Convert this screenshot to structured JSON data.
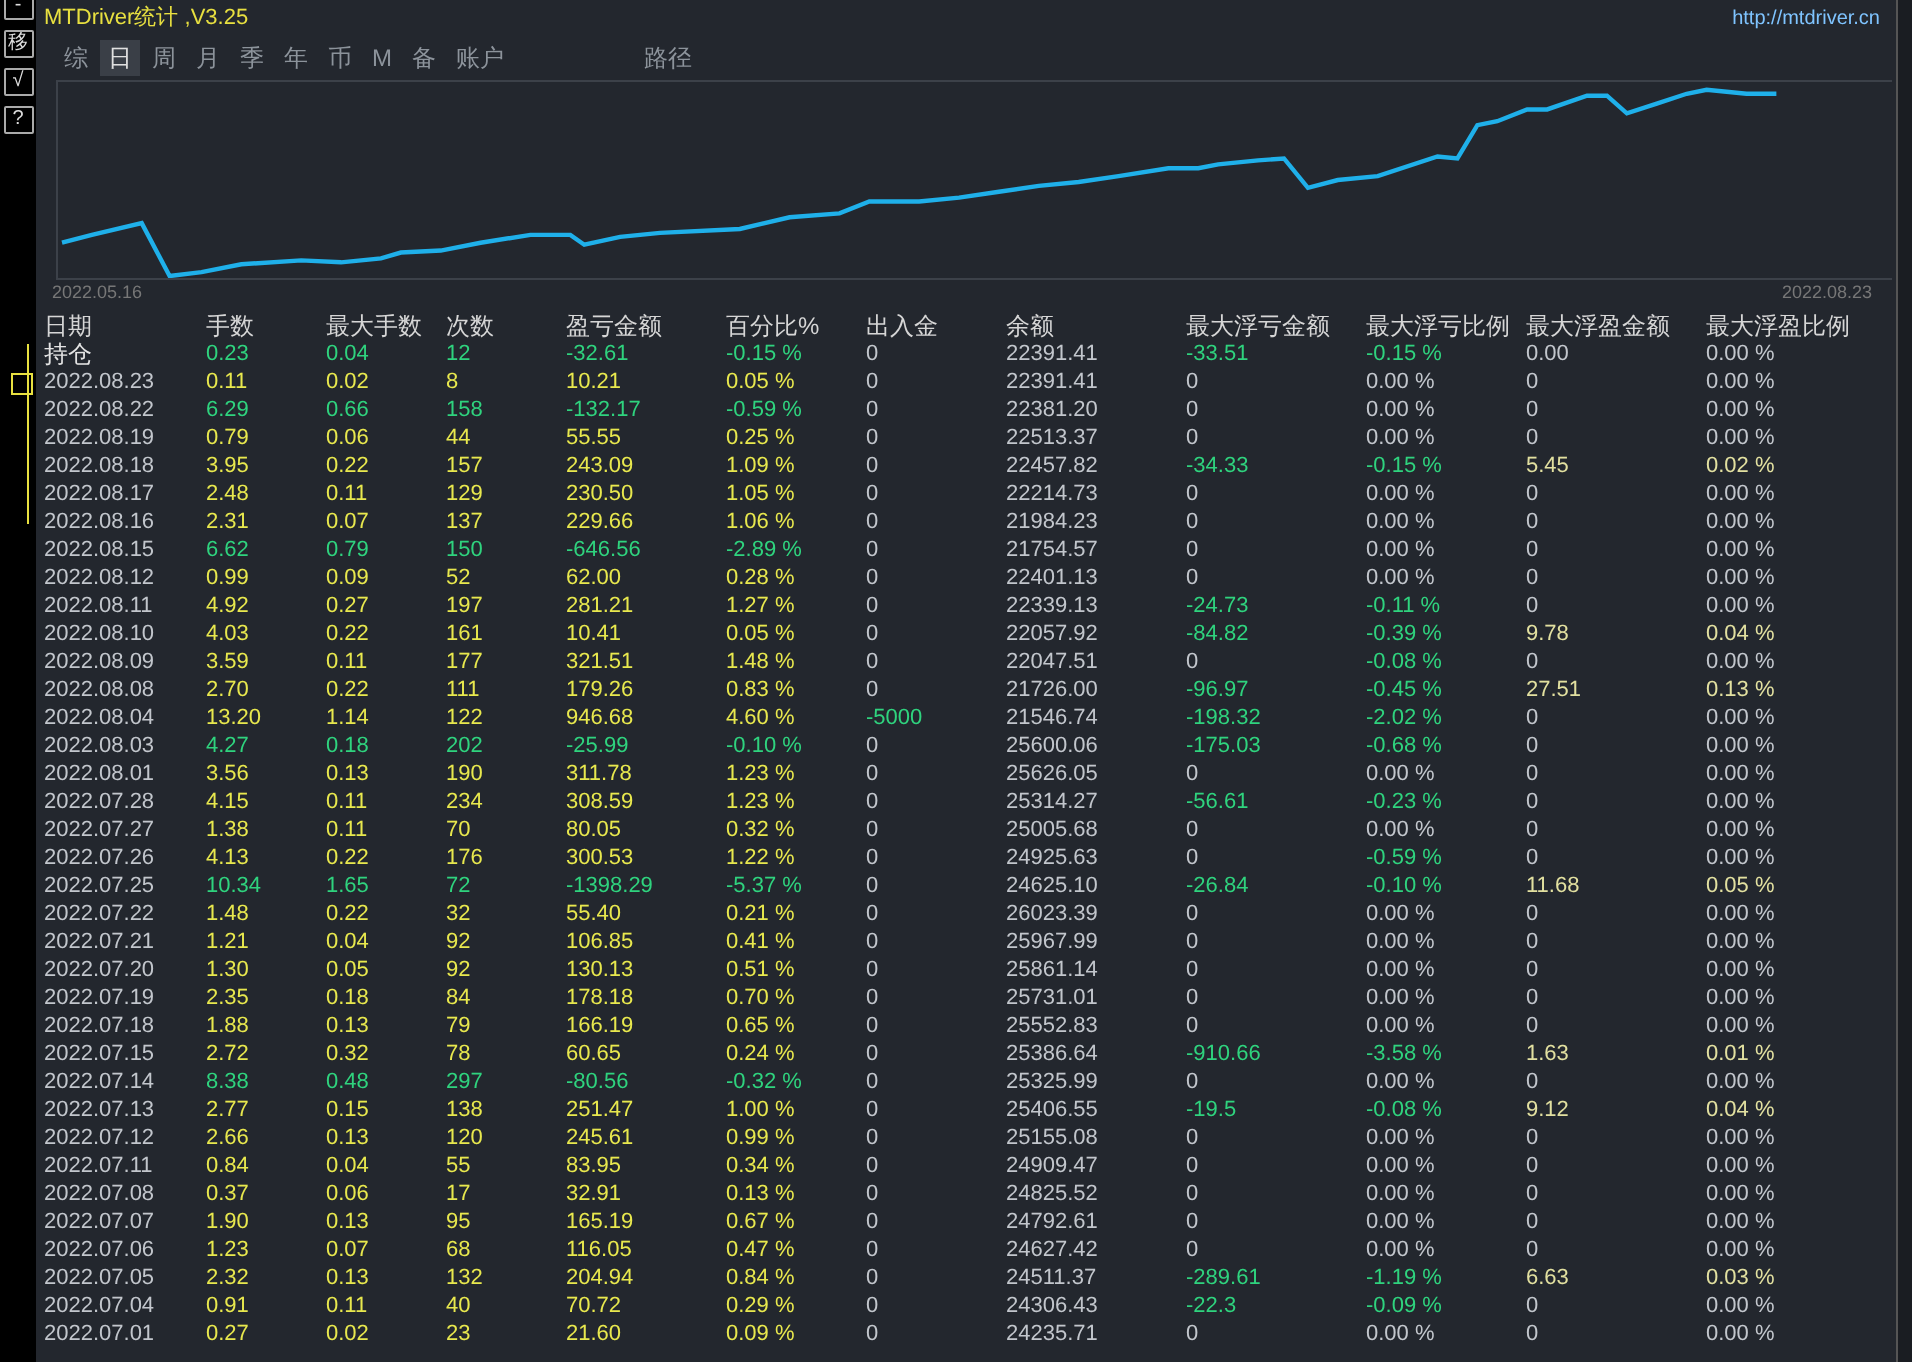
{
  "side_buttons": [
    "-",
    "移",
    "√",
    "?"
  ],
  "header": {
    "title": "MTDriver统计 ,V3.25",
    "url": "http://mtdriver.cn"
  },
  "tabs": [
    {
      "label": "综",
      "selected": false
    },
    {
      "label": "日",
      "selected": true
    },
    {
      "label": "周",
      "selected": false
    },
    {
      "label": "月",
      "selected": false
    },
    {
      "label": "季",
      "selected": false
    },
    {
      "label": "年",
      "selected": false
    },
    {
      "label": "币",
      "selected": false
    },
    {
      "label": "M",
      "selected": false
    },
    {
      "label": "备",
      "selected": false
    },
    {
      "label": "账户",
      "selected": false
    },
    {
      "label": "路径",
      "selected": false
    }
  ],
  "chart": {
    "start_label": "2022.05.16",
    "end_label": "2022.08.23"
  },
  "table": {
    "columns": [
      "日期",
      "手数",
      "最大手数",
      "次数",
      "盈亏金额",
      "百分比%",
      "出入金",
      "余额",
      "最大浮亏金额",
      "最大浮亏比例",
      "最大浮盈金额",
      "最大浮盈比例"
    ],
    "rows": [
      {
        "kind": "position",
        "cells": [
          "持仓",
          "0.23",
          "0.04",
          "12",
          "-32.61",
          "-0.15 %",
          "0",
          "22391.41",
          "-33.51",
          "-0.15 %",
          "0.00",
          "0.00 %"
        ],
        "deposit_marked": false,
        "float_loss_marked": true,
        "float_loss_pct_marked": true,
        "float_profit_marked": false
      },
      {
        "kind": "gain",
        "cells": [
          "2022.08.23",
          "0.11",
          "0.02",
          "8",
          "10.21",
          "0.05 %",
          "0",
          "22391.41",
          "0",
          "0.00 %",
          "0",
          "0.00 %"
        ],
        "deposit_marked": false,
        "float_loss_marked": false,
        "float_loss_pct_marked": false,
        "float_profit_marked": false
      },
      {
        "kind": "loss",
        "cells": [
          "2022.08.22",
          "6.29",
          "0.66",
          "158",
          "-132.17",
          "-0.59 %",
          "0",
          "22381.20",
          "0",
          "0.00 %",
          "0",
          "0.00 %"
        ],
        "deposit_marked": false,
        "float_loss_marked": false,
        "float_loss_pct_marked": false,
        "float_profit_marked": false
      },
      {
        "kind": "gain",
        "cells": [
          "2022.08.19",
          "0.79",
          "0.06",
          "44",
          "55.55",
          "0.25 %",
          "0",
          "22513.37",
          "0",
          "0.00 %",
          "0",
          "0.00 %"
        ],
        "deposit_marked": false,
        "float_loss_marked": false,
        "float_loss_pct_marked": false,
        "float_profit_marked": false
      },
      {
        "kind": "gain",
        "cells": [
          "2022.08.18",
          "3.95",
          "0.22",
          "157",
          "243.09",
          "1.09 %",
          "0",
          "22457.82",
          "-34.33",
          "-0.15 %",
          "5.45",
          "0.02 %"
        ],
        "deposit_marked": false,
        "float_loss_marked": true,
        "float_loss_pct_marked": true,
        "float_profit_marked": true
      },
      {
        "kind": "gain",
        "cells": [
          "2022.08.17",
          "2.48",
          "0.11",
          "129",
          "230.50",
          "1.05 %",
          "0",
          "22214.73",
          "0",
          "0.00 %",
          "0",
          "0.00 %"
        ],
        "deposit_marked": false,
        "float_loss_marked": false,
        "float_loss_pct_marked": false,
        "float_profit_marked": false
      },
      {
        "kind": "gain",
        "cells": [
          "2022.08.16",
          "2.31",
          "0.07",
          "137",
          "229.66",
          "1.06 %",
          "0",
          "21984.23",
          "0",
          "0.00 %",
          "0",
          "0.00 %"
        ],
        "deposit_marked": false,
        "float_loss_marked": false,
        "float_loss_pct_marked": false,
        "float_profit_marked": false
      },
      {
        "kind": "loss",
        "cells": [
          "2022.08.15",
          "6.62",
          "0.79",
          "150",
          "-646.56",
          "-2.89 %",
          "0",
          "21754.57",
          "0",
          "0.00 %",
          "0",
          "0.00 %"
        ],
        "deposit_marked": false,
        "float_loss_marked": false,
        "float_loss_pct_marked": false,
        "float_profit_marked": false
      },
      {
        "kind": "gain",
        "cells": [
          "2022.08.12",
          "0.99",
          "0.09",
          "52",
          "62.00",
          "0.28 %",
          "0",
          "22401.13",
          "0",
          "0.00 %",
          "0",
          "0.00 %"
        ],
        "deposit_marked": false,
        "float_loss_marked": false,
        "float_loss_pct_marked": false,
        "float_profit_marked": false
      },
      {
        "kind": "gain",
        "cells": [
          "2022.08.11",
          "4.92",
          "0.27",
          "197",
          "281.21",
          "1.27 %",
          "0",
          "22339.13",
          "-24.73",
          "-0.11 %",
          "0",
          "0.00 %"
        ],
        "deposit_marked": false,
        "float_loss_marked": true,
        "float_loss_pct_marked": true,
        "float_profit_marked": false
      },
      {
        "kind": "gain",
        "cells": [
          "2022.08.10",
          "4.03",
          "0.22",
          "161",
          "10.41",
          "0.05 %",
          "0",
          "22057.92",
          "-84.82",
          "-0.39 %",
          "9.78",
          "0.04 %"
        ],
        "deposit_marked": false,
        "float_loss_marked": true,
        "float_loss_pct_marked": true,
        "float_profit_marked": true
      },
      {
        "kind": "gain",
        "cells": [
          "2022.08.09",
          "3.59",
          "0.11",
          "177",
          "321.51",
          "1.48 %",
          "0",
          "22047.51",
          "0",
          "-0.08 %",
          "0",
          "0.00 %"
        ],
        "deposit_marked": false,
        "float_loss_marked": false,
        "float_loss_pct_marked": true,
        "float_profit_marked": false
      },
      {
        "kind": "gain",
        "cells": [
          "2022.08.08",
          "2.70",
          "0.22",
          "111",
          "179.26",
          "0.83 %",
          "0",
          "21726.00",
          "-96.97",
          "-0.45 %",
          "27.51",
          "0.13 %"
        ],
        "deposit_marked": false,
        "float_loss_marked": true,
        "float_loss_pct_marked": true,
        "float_profit_marked": true
      },
      {
        "kind": "gain",
        "cells": [
          "2022.08.04",
          "13.20",
          "1.14",
          "122",
          "946.68",
          "4.60 %",
          "-5000",
          "21546.74",
          "-198.32",
          "-2.02 %",
          "0",
          "0.00 %"
        ],
        "deposit_marked": true,
        "float_loss_marked": true,
        "float_loss_pct_marked": true,
        "float_profit_marked": false
      },
      {
        "kind": "loss",
        "cells": [
          "2022.08.03",
          "4.27",
          "0.18",
          "202",
          "-25.99",
          "-0.10 %",
          "0",
          "25600.06",
          "-175.03",
          "-0.68 %",
          "0",
          "0.00 %"
        ],
        "deposit_marked": false,
        "float_loss_marked": true,
        "float_loss_pct_marked": true,
        "float_profit_marked": false
      },
      {
        "kind": "gain",
        "cells": [
          "2022.08.01",
          "3.56",
          "0.13",
          "190",
          "311.78",
          "1.23 %",
          "0",
          "25626.05",
          "0",
          "0.00 %",
          "0",
          "0.00 %"
        ],
        "deposit_marked": false,
        "float_loss_marked": false,
        "float_loss_pct_marked": false,
        "float_profit_marked": false
      },
      {
        "kind": "gain",
        "cells": [
          "2022.07.28",
          "4.15",
          "0.11",
          "234",
          "308.59",
          "1.23 %",
          "0",
          "25314.27",
          "-56.61",
          "-0.23 %",
          "0",
          "0.00 %"
        ],
        "deposit_marked": false,
        "float_loss_marked": true,
        "float_loss_pct_marked": true,
        "float_profit_marked": false
      },
      {
        "kind": "gain",
        "cells": [
          "2022.07.27",
          "1.38",
          "0.11",
          "70",
          "80.05",
          "0.32 %",
          "0",
          "25005.68",
          "0",
          "0.00 %",
          "0",
          "0.00 %"
        ],
        "deposit_marked": false,
        "float_loss_marked": false,
        "float_loss_pct_marked": false,
        "float_profit_marked": false
      },
      {
        "kind": "gain",
        "cells": [
          "2022.07.26",
          "4.13",
          "0.22",
          "176",
          "300.53",
          "1.22 %",
          "0",
          "24925.63",
          "0",
          "-0.59 %",
          "0",
          "0.00 %"
        ],
        "deposit_marked": false,
        "float_loss_marked": false,
        "float_loss_pct_marked": true,
        "float_profit_marked": false
      },
      {
        "kind": "loss",
        "cells": [
          "2022.07.25",
          "10.34",
          "1.65",
          "72",
          "-1398.29",
          "-5.37 %",
          "0",
          "24625.10",
          "-26.84",
          "-0.10 %",
          "11.68",
          "0.05 %"
        ],
        "deposit_marked": false,
        "float_loss_marked": true,
        "float_loss_pct_marked": true,
        "float_profit_marked": true
      },
      {
        "kind": "gain",
        "cells": [
          "2022.07.22",
          "1.48",
          "0.22",
          "32",
          "55.40",
          "0.21 %",
          "0",
          "26023.39",
          "0",
          "0.00 %",
          "0",
          "0.00 %"
        ],
        "deposit_marked": false,
        "float_loss_marked": false,
        "float_loss_pct_marked": false,
        "float_profit_marked": false
      },
      {
        "kind": "gain",
        "cells": [
          "2022.07.21",
          "1.21",
          "0.04",
          "92",
          "106.85",
          "0.41 %",
          "0",
          "25967.99",
          "0",
          "0.00 %",
          "0",
          "0.00 %"
        ],
        "deposit_marked": false,
        "float_loss_marked": false,
        "float_loss_pct_marked": false,
        "float_profit_marked": false
      },
      {
        "kind": "gain",
        "cells": [
          "2022.07.20",
          "1.30",
          "0.05",
          "92",
          "130.13",
          "0.51 %",
          "0",
          "25861.14",
          "0",
          "0.00 %",
          "0",
          "0.00 %"
        ],
        "deposit_marked": false,
        "float_loss_marked": false,
        "float_loss_pct_marked": false,
        "float_profit_marked": false
      },
      {
        "kind": "gain",
        "cells": [
          "2022.07.19",
          "2.35",
          "0.18",
          "84",
          "178.18",
          "0.70 %",
          "0",
          "25731.01",
          "0",
          "0.00 %",
          "0",
          "0.00 %"
        ],
        "deposit_marked": false,
        "float_loss_marked": false,
        "float_loss_pct_marked": false,
        "float_profit_marked": false
      },
      {
        "kind": "gain",
        "cells": [
          "2022.07.18",
          "1.88",
          "0.13",
          "79",
          "166.19",
          "0.65 %",
          "0",
          "25552.83",
          "0",
          "0.00 %",
          "0",
          "0.00 %"
        ],
        "deposit_marked": false,
        "float_loss_marked": false,
        "float_loss_pct_marked": false,
        "float_profit_marked": false
      },
      {
        "kind": "gain",
        "cells": [
          "2022.07.15",
          "2.72",
          "0.32",
          "78",
          "60.65",
          "0.24 %",
          "0",
          "25386.64",
          "-910.66",
          "-3.58 %",
          "1.63",
          "0.01 %"
        ],
        "deposit_marked": false,
        "float_loss_marked": true,
        "float_loss_pct_marked": true,
        "float_profit_marked": true
      },
      {
        "kind": "loss",
        "cells": [
          "2022.07.14",
          "8.38",
          "0.48",
          "297",
          "-80.56",
          "-0.32 %",
          "0",
          "25325.99",
          "0",
          "0.00 %",
          "0",
          "0.00 %"
        ],
        "deposit_marked": false,
        "float_loss_marked": false,
        "float_loss_pct_marked": false,
        "float_profit_marked": false
      },
      {
        "kind": "gain",
        "cells": [
          "2022.07.13",
          "2.77",
          "0.15",
          "138",
          "251.47",
          "1.00 %",
          "0",
          "25406.55",
          "-19.5",
          "-0.08 %",
          "9.12",
          "0.04 %"
        ],
        "deposit_marked": false,
        "float_loss_marked": true,
        "float_loss_pct_marked": true,
        "float_profit_marked": true
      },
      {
        "kind": "gain",
        "cells": [
          "2022.07.12",
          "2.66",
          "0.13",
          "120",
          "245.61",
          "0.99 %",
          "0",
          "25155.08",
          "0",
          "0.00 %",
          "0",
          "0.00 %"
        ],
        "deposit_marked": false,
        "float_loss_marked": false,
        "float_loss_pct_marked": false,
        "float_profit_marked": false
      },
      {
        "kind": "gain",
        "cells": [
          "2022.07.11",
          "0.84",
          "0.04",
          "55",
          "83.95",
          "0.34 %",
          "0",
          "24909.47",
          "0",
          "0.00 %",
          "0",
          "0.00 %"
        ],
        "deposit_marked": false,
        "float_loss_marked": false,
        "float_loss_pct_marked": false,
        "float_profit_marked": false
      },
      {
        "kind": "gain",
        "cells": [
          "2022.07.08",
          "0.37",
          "0.06",
          "17",
          "32.91",
          "0.13 %",
          "0",
          "24825.52",
          "0",
          "0.00 %",
          "0",
          "0.00 %"
        ],
        "deposit_marked": false,
        "float_loss_marked": false,
        "float_loss_pct_marked": false,
        "float_profit_marked": false
      },
      {
        "kind": "gain",
        "cells": [
          "2022.07.07",
          "1.90",
          "0.13",
          "95",
          "165.19",
          "0.67 %",
          "0",
          "24792.61",
          "0",
          "0.00 %",
          "0",
          "0.00 %"
        ],
        "deposit_marked": false,
        "float_loss_marked": false,
        "float_loss_pct_marked": false,
        "float_profit_marked": false
      },
      {
        "kind": "gain",
        "cells": [
          "2022.07.06",
          "1.23",
          "0.07",
          "68",
          "116.05",
          "0.47 %",
          "0",
          "24627.42",
          "0",
          "0.00 %",
          "0",
          "0.00 %"
        ],
        "deposit_marked": false,
        "float_loss_marked": false,
        "float_loss_pct_marked": false,
        "float_profit_marked": false
      },
      {
        "kind": "gain",
        "cells": [
          "2022.07.05",
          "2.32",
          "0.13",
          "132",
          "204.94",
          "0.84 %",
          "0",
          "24511.37",
          "-289.61",
          "-1.19 %",
          "6.63",
          "0.03 %"
        ],
        "deposit_marked": false,
        "float_loss_marked": true,
        "float_loss_pct_marked": true,
        "float_profit_marked": true
      },
      {
        "kind": "gain",
        "cells": [
          "2022.07.04",
          "0.91",
          "0.11",
          "40",
          "70.72",
          "0.29 %",
          "0",
          "24306.43",
          "-22.3",
          "-0.09 %",
          "0",
          "0.00 %"
        ],
        "deposit_marked": false,
        "float_loss_marked": true,
        "float_loss_pct_marked": true,
        "float_profit_marked": false
      },
      {
        "kind": "gain",
        "cells": [
          "2022.07.01",
          "0.27",
          "0.02",
          "23",
          "21.60",
          "0.09 %",
          "0",
          "24235.71",
          "0",
          "0.00 %",
          "0",
          "0.00 %"
        ],
        "deposit_marked": false,
        "float_loss_marked": false,
        "float_loss_pct_marked": false,
        "float_profit_marked": false
      }
    ]
  }
}
